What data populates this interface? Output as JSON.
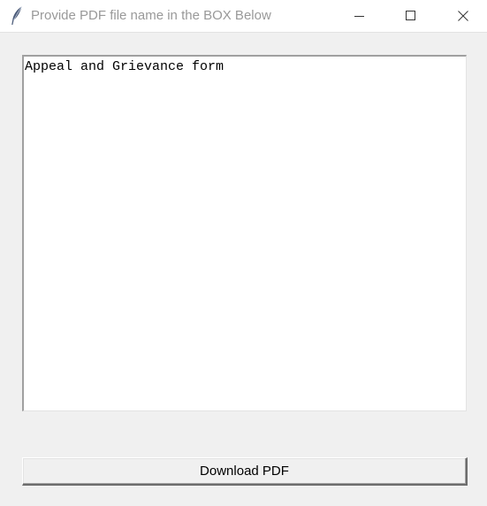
{
  "window": {
    "title": "Provide PDF file name in the BOX Below",
    "icon": "feather-icon",
    "controls": [
      "minimize-icon",
      "maximize-icon",
      "close-icon"
    ]
  },
  "textbox": {
    "value": "Appeal and Grievance form"
  },
  "actions": {
    "download_label": "Download PDF"
  },
  "colors": {
    "title_text": "#999999",
    "background": "#f0f0f0",
    "textbox_bg": "#ffffff"
  }
}
